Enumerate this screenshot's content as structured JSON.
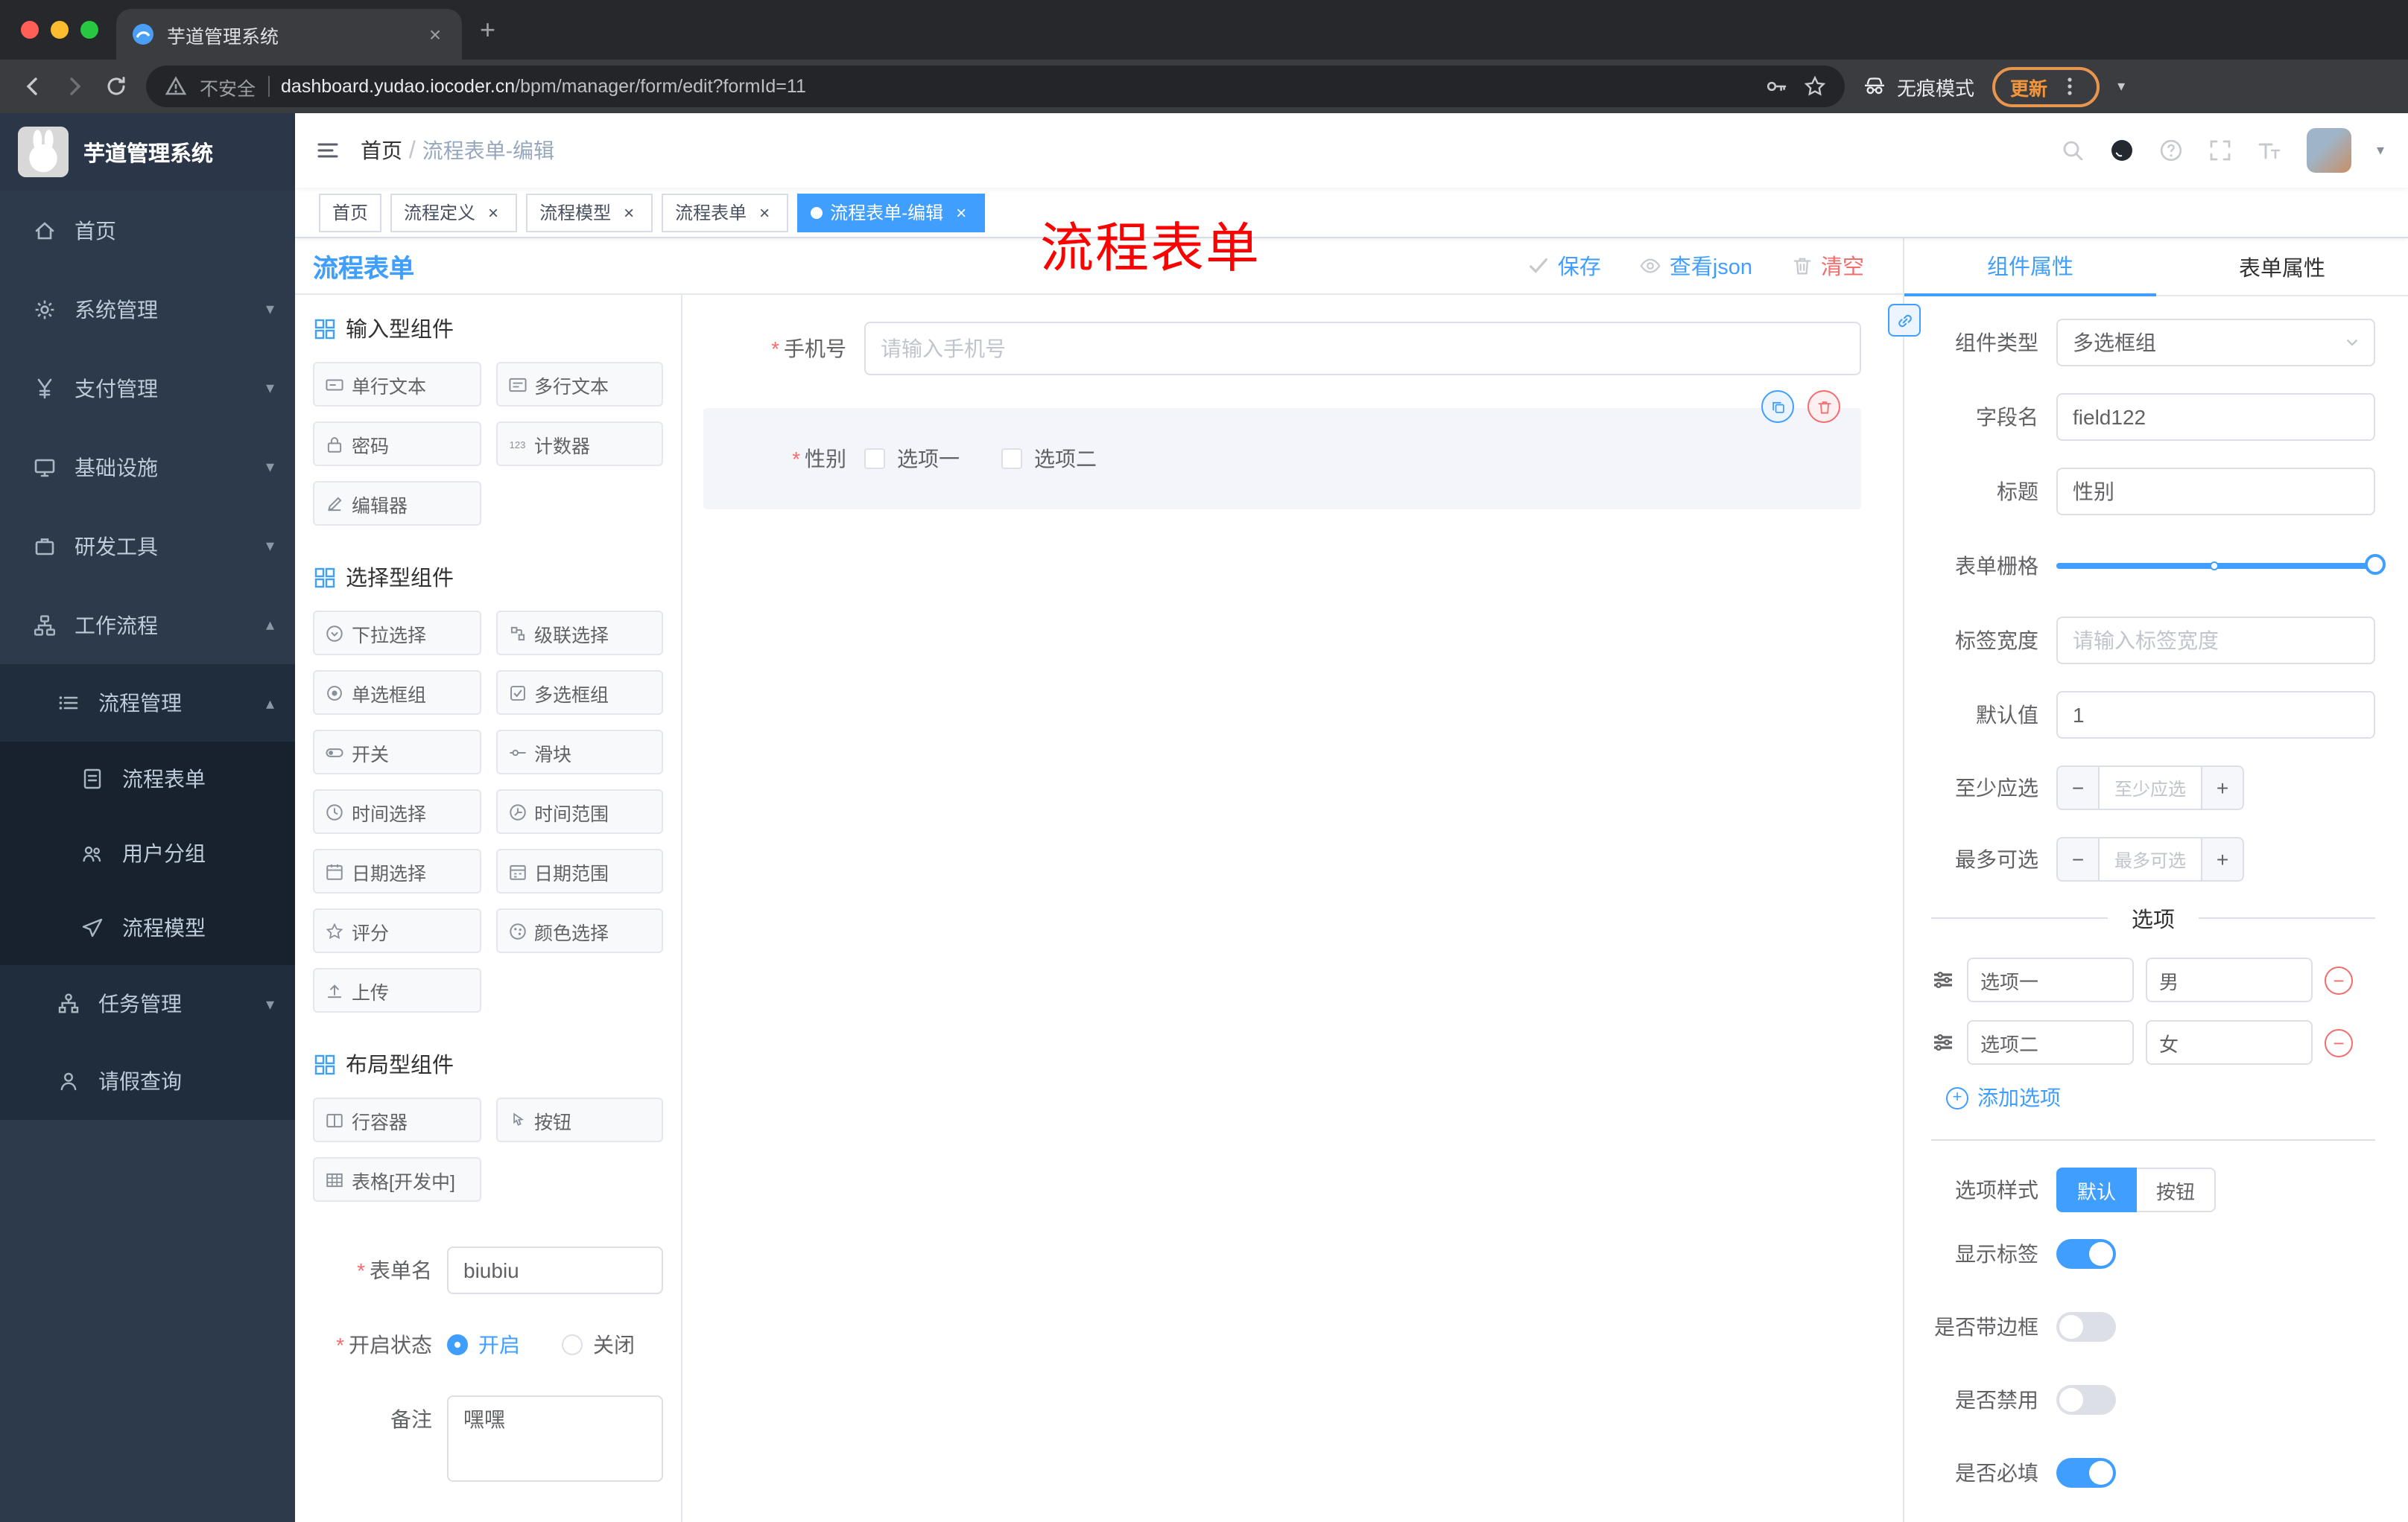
{
  "colors": {
    "accent": "#409eff",
    "danger": "#f56c6c",
    "sidebar_bg": "#2d3a4b",
    "active_tag_bg": "#409eff",
    "annotation_red": "#fb0200",
    "update_orange": "#f0953b"
  },
  "browser": {
    "tab_title": "芋道管理系统",
    "security_label": "不安全",
    "url_domain": "dashboard.yudao.iocoder.cn",
    "url_path": "/bpm/manager/form/edit?formId=11",
    "incognito_label": "无痕模式",
    "update_label": "更新"
  },
  "sidebar": {
    "logo_title": "芋道管理系统",
    "items": [
      {
        "label": "首页",
        "icon": "home-icon"
      },
      {
        "label": "系统管理",
        "icon": "gear-icon",
        "chevron": "down"
      },
      {
        "label": "支付管理",
        "icon": "yen-icon",
        "chevron": "down"
      },
      {
        "label": "基础设施",
        "icon": "infrastructure-icon",
        "chevron": "down"
      },
      {
        "label": "研发工具",
        "icon": "dev-tools-icon",
        "chevron": "down"
      },
      {
        "label": "工作流程",
        "icon": "workflow-icon",
        "chevron": "up"
      },
      {
        "label": "流程管理",
        "icon": "process-manage-icon",
        "chevron": "up"
      },
      {
        "label": "流程表单",
        "icon": "process-form-icon"
      },
      {
        "label": "用户分组",
        "icon": "user-group-icon"
      },
      {
        "label": "流程模型",
        "icon": "process-model-icon"
      },
      {
        "label": "任务管理",
        "icon": "task-manage-icon",
        "chevron": "down"
      },
      {
        "label": "请假查询",
        "icon": "leave-query-icon"
      }
    ]
  },
  "header": {
    "breadcrumb_home": "首页",
    "breadcrumb_sep": "/",
    "breadcrumb_current": "流程表单-编辑",
    "overlay_title": "流程表单"
  },
  "tags": [
    {
      "label": "首页"
    },
    {
      "label": "流程定义"
    },
    {
      "label": "流程模型"
    },
    {
      "label": "流程表单"
    },
    {
      "label": "流程表单-编辑"
    }
  ],
  "designer": {
    "title": "流程表单",
    "save": "保存",
    "view_json": "查看json",
    "clear": "清空"
  },
  "palette": {
    "groups": [
      {
        "title": "输入型组件"
      },
      {
        "title": "选择型组件"
      },
      {
        "title": "布局型组件"
      }
    ],
    "input_items": [
      "单行文本",
      "多行文本",
      "密码",
      "计数器",
      "编辑器"
    ],
    "select_items": [
      "下拉选择",
      "级联选择",
      "单选框组",
      "多选框组",
      "开关",
      "滑块",
      "时间选择",
      "时间范围",
      "日期选择",
      "日期范围",
      "评分",
      "颜色选择",
      "上传"
    ],
    "layout_items": [
      "行容器",
      "按钮",
      "表格[开发中]"
    ]
  },
  "form_settings": {
    "name_label": "表单名",
    "name_value": "biubiu",
    "status_label": "开启状态",
    "status_on": "开启",
    "status_off": "关闭",
    "remark_label": "备注",
    "remark_value": "嘿嘿"
  },
  "canvas": {
    "phone_label": "手机号",
    "phone_placeholder": "请输入手机号",
    "gender_label": "性别",
    "gender_option1": "选项一",
    "gender_option2": "选项二"
  },
  "props": {
    "tab_component": "组件属性",
    "tab_form": "表单属性",
    "component_type_label": "组件类型",
    "component_type_value": "多选框组",
    "field_name_label": "字段名",
    "field_name_value": "field122",
    "title_label": "标题",
    "title_value": "性别",
    "grid_label": "表单栅格",
    "label_width_label": "标签宽度",
    "label_width_placeholder": "请输入标签宽度",
    "default_label": "默认值",
    "default_value": "1",
    "min_label": "至少应选",
    "min_placeholder": "至少应选",
    "max_label": "最多可选",
    "max_placeholder": "最多可选",
    "options_title": "选项",
    "options": [
      {
        "label": "选项一",
        "value": "男"
      },
      {
        "label": "选项二",
        "value": "女"
      }
    ],
    "add_option": "添加选项",
    "style_label": "选项样式",
    "style_default": "默认",
    "style_button": "按钮",
    "toggle_show_label": "显示标签",
    "toggle_border": "是否带边框",
    "toggle_disabled": "是否禁用",
    "toggle_required": "是否必填"
  }
}
